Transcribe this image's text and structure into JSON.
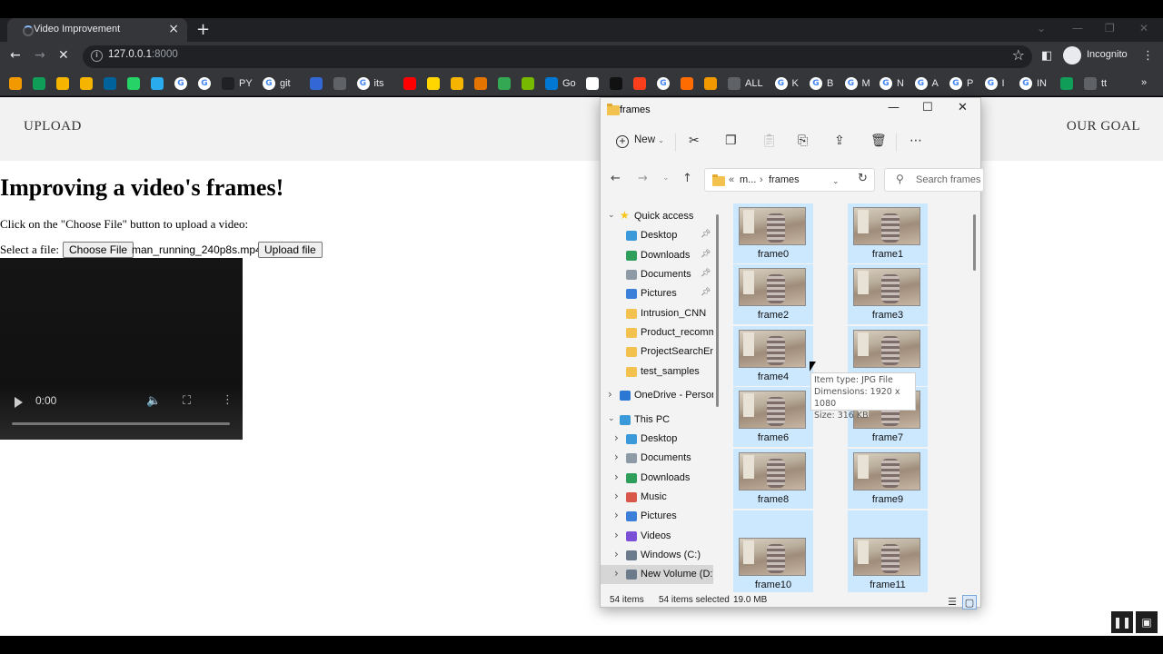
{
  "browser": {
    "tab_title": "Video Improvement",
    "url_host": "127.0.0.1",
    "url_port": ":8000",
    "profile_label": "Incognito",
    "bookmarks": [
      {
        "icon": "bookmark-arrow-icon",
        "label": ""
      },
      {
        "icon": "plus-sheet-icon",
        "label": ""
      },
      {
        "icon": "orange-app-icon",
        "label": ""
      },
      {
        "icon": "bar-chart-icon",
        "label": ""
      },
      {
        "icon": "ieee-icon",
        "label": ""
      },
      {
        "icon": "whatsapp-icon",
        "label": ""
      },
      {
        "icon": "telegram-icon",
        "label": ""
      },
      {
        "icon": "google-icon",
        "label": ""
      },
      {
        "icon": "google-icon",
        "label": ""
      },
      {
        "icon": "dark-circle-icon",
        "label": "PY"
      },
      {
        "icon": "google-icon",
        "label": "git"
      },
      {
        "icon": "blue-doc-icon",
        "label": ""
      },
      {
        "icon": "car-icon",
        "label": ""
      },
      {
        "icon": "google-icon",
        "label": "its"
      },
      {
        "icon": "youtube-icon",
        "label": ""
      },
      {
        "icon": "p-icon",
        "label": ""
      },
      {
        "icon": "camera-icon",
        "label": ""
      },
      {
        "icon": "bucket-icon",
        "label": ""
      },
      {
        "icon": "green-ring-icon",
        "label": ""
      },
      {
        "icon": "nvidia-icon",
        "label": ""
      },
      {
        "icon": "edge-icon",
        "label": "Go"
      },
      {
        "icon": "file-icon",
        "label": ""
      },
      {
        "icon": "cl-icon",
        "label": ""
      },
      {
        "icon": "yandex-icon",
        "label": ""
      },
      {
        "icon": "google-icon",
        "label": ""
      },
      {
        "icon": "arrow-icon",
        "label": ""
      },
      {
        "icon": "tag-icon",
        "label": ""
      },
      {
        "icon": "globe-icon",
        "label": "ALL"
      },
      {
        "icon": "google-icon",
        "label": "K"
      },
      {
        "icon": "google-icon",
        "label": "B"
      },
      {
        "icon": "google-icon",
        "label": "M"
      },
      {
        "icon": "google-icon",
        "label": "N"
      },
      {
        "icon": "google-icon",
        "label": "A"
      },
      {
        "icon": "google-icon",
        "label": "P"
      },
      {
        "icon": "google-icon",
        "label": "I"
      },
      {
        "icon": "google-icon",
        "label": "IN"
      },
      {
        "icon": "code-icon",
        "label": ""
      },
      {
        "icon": "printer-icon",
        "label": "tt"
      }
    ],
    "bookmarks_overflow": "»"
  },
  "page": {
    "nav_upload": "UPLOAD",
    "nav_goal": "OUR GOAL",
    "heading": "Improving a video's frames!",
    "instructions": "Click on the \"Choose File\" button to upload a video:",
    "select_label": "Select a file:",
    "choose_file": "Choose File",
    "file_name": "man_running_240p8s.mp4",
    "upload_button": "Upload file",
    "video_time": "0:00",
    "video_progress": 0
  },
  "explorer": {
    "title": "frames",
    "new_label": "New",
    "path_prefix": "«",
    "path_mid": "m...",
    "path_current": "frames",
    "search_placeholder": "Search frames",
    "nav": [
      {
        "label": "Quick access",
        "icon": "star-icon",
        "color": "#f5c518",
        "level": 0,
        "chevron": "v",
        "pin": false
      },
      {
        "label": "Desktop",
        "icon": "desktop-icon",
        "color": "#3a9ad9",
        "level": 1,
        "chevron": "",
        "pin": true
      },
      {
        "label": "Downloads",
        "icon": "download-icon",
        "color": "#2e9e5b",
        "level": 1,
        "chevron": "",
        "pin": true
      },
      {
        "label": "Documents",
        "icon": "documents-icon",
        "color": "#8e9aa6",
        "level": 1,
        "chevron": "",
        "pin": true
      },
      {
        "label": "Pictures",
        "icon": "pictures-icon",
        "color": "#3b7fd9",
        "level": 1,
        "chevron": "",
        "pin": true
      },
      {
        "label": "Intrusion_CNN",
        "icon": "folder-icon",
        "color": "#f2c14e",
        "level": 1,
        "chevron": "",
        "pin": false
      },
      {
        "label": "Product_recomme",
        "icon": "folder-icon",
        "color": "#f2c14e",
        "level": 1,
        "chevron": "",
        "pin": false
      },
      {
        "label": "ProjectSearchEng",
        "icon": "folder-icon",
        "color": "#f2c14e",
        "level": 1,
        "chevron": "",
        "pin": false
      },
      {
        "label": "test_samples",
        "icon": "folder-icon",
        "color": "#f2c14e",
        "level": 1,
        "chevron": "",
        "pin": false
      },
      {
        "label": "OneDrive - Persona",
        "icon": "onedrive-icon",
        "color": "#2b78d4",
        "level": 0,
        "chevron": ">",
        "pin": false
      },
      {
        "label": "This PC",
        "icon": "pc-icon",
        "color": "#3a9ad9",
        "level": 0,
        "chevron": "v",
        "pin": false
      },
      {
        "label": "Desktop",
        "icon": "desktop-icon",
        "color": "#3a9ad9",
        "level": 1,
        "chevron": ">",
        "pin": false
      },
      {
        "label": "Documents",
        "icon": "documents-icon",
        "color": "#8e9aa6",
        "level": 1,
        "chevron": ">",
        "pin": false
      },
      {
        "label": "Downloads",
        "icon": "download-icon",
        "color": "#2e9e5b",
        "level": 1,
        "chevron": ">",
        "pin": false
      },
      {
        "label": "Music",
        "icon": "music-icon",
        "color": "#d9574a",
        "level": 1,
        "chevron": ">",
        "pin": false
      },
      {
        "label": "Pictures",
        "icon": "pictures-icon",
        "color": "#3b7fd9",
        "level": 1,
        "chevron": ">",
        "pin": false
      },
      {
        "label": "Videos",
        "icon": "videos-icon",
        "color": "#7b4fd6",
        "level": 1,
        "chevron": ">",
        "pin": false
      },
      {
        "label": "Windows (C:)",
        "icon": "drive-icon",
        "color": "#6b7b8c",
        "level": 1,
        "chevron": ">",
        "pin": false
      },
      {
        "label": "New Volume (D:)",
        "icon": "drive-icon",
        "color": "#6b7b8c",
        "level": 1,
        "chevron": ">",
        "pin": false,
        "selected": true
      }
    ],
    "files": [
      "frame0",
      "frame1",
      "frame2",
      "frame3",
      "frame4",
      "frame5",
      "frame6",
      "frame7",
      "frame8",
      "frame9",
      "frame10",
      "frame11"
    ],
    "tooltip": {
      "type": "Item type: JPG File",
      "dimensions": "Dimensions: 1920 x 1080",
      "size": "Size: 316 KB"
    },
    "status_count": "54 items",
    "status_selected": "54 items selected",
    "status_size": "19.0 MB"
  }
}
